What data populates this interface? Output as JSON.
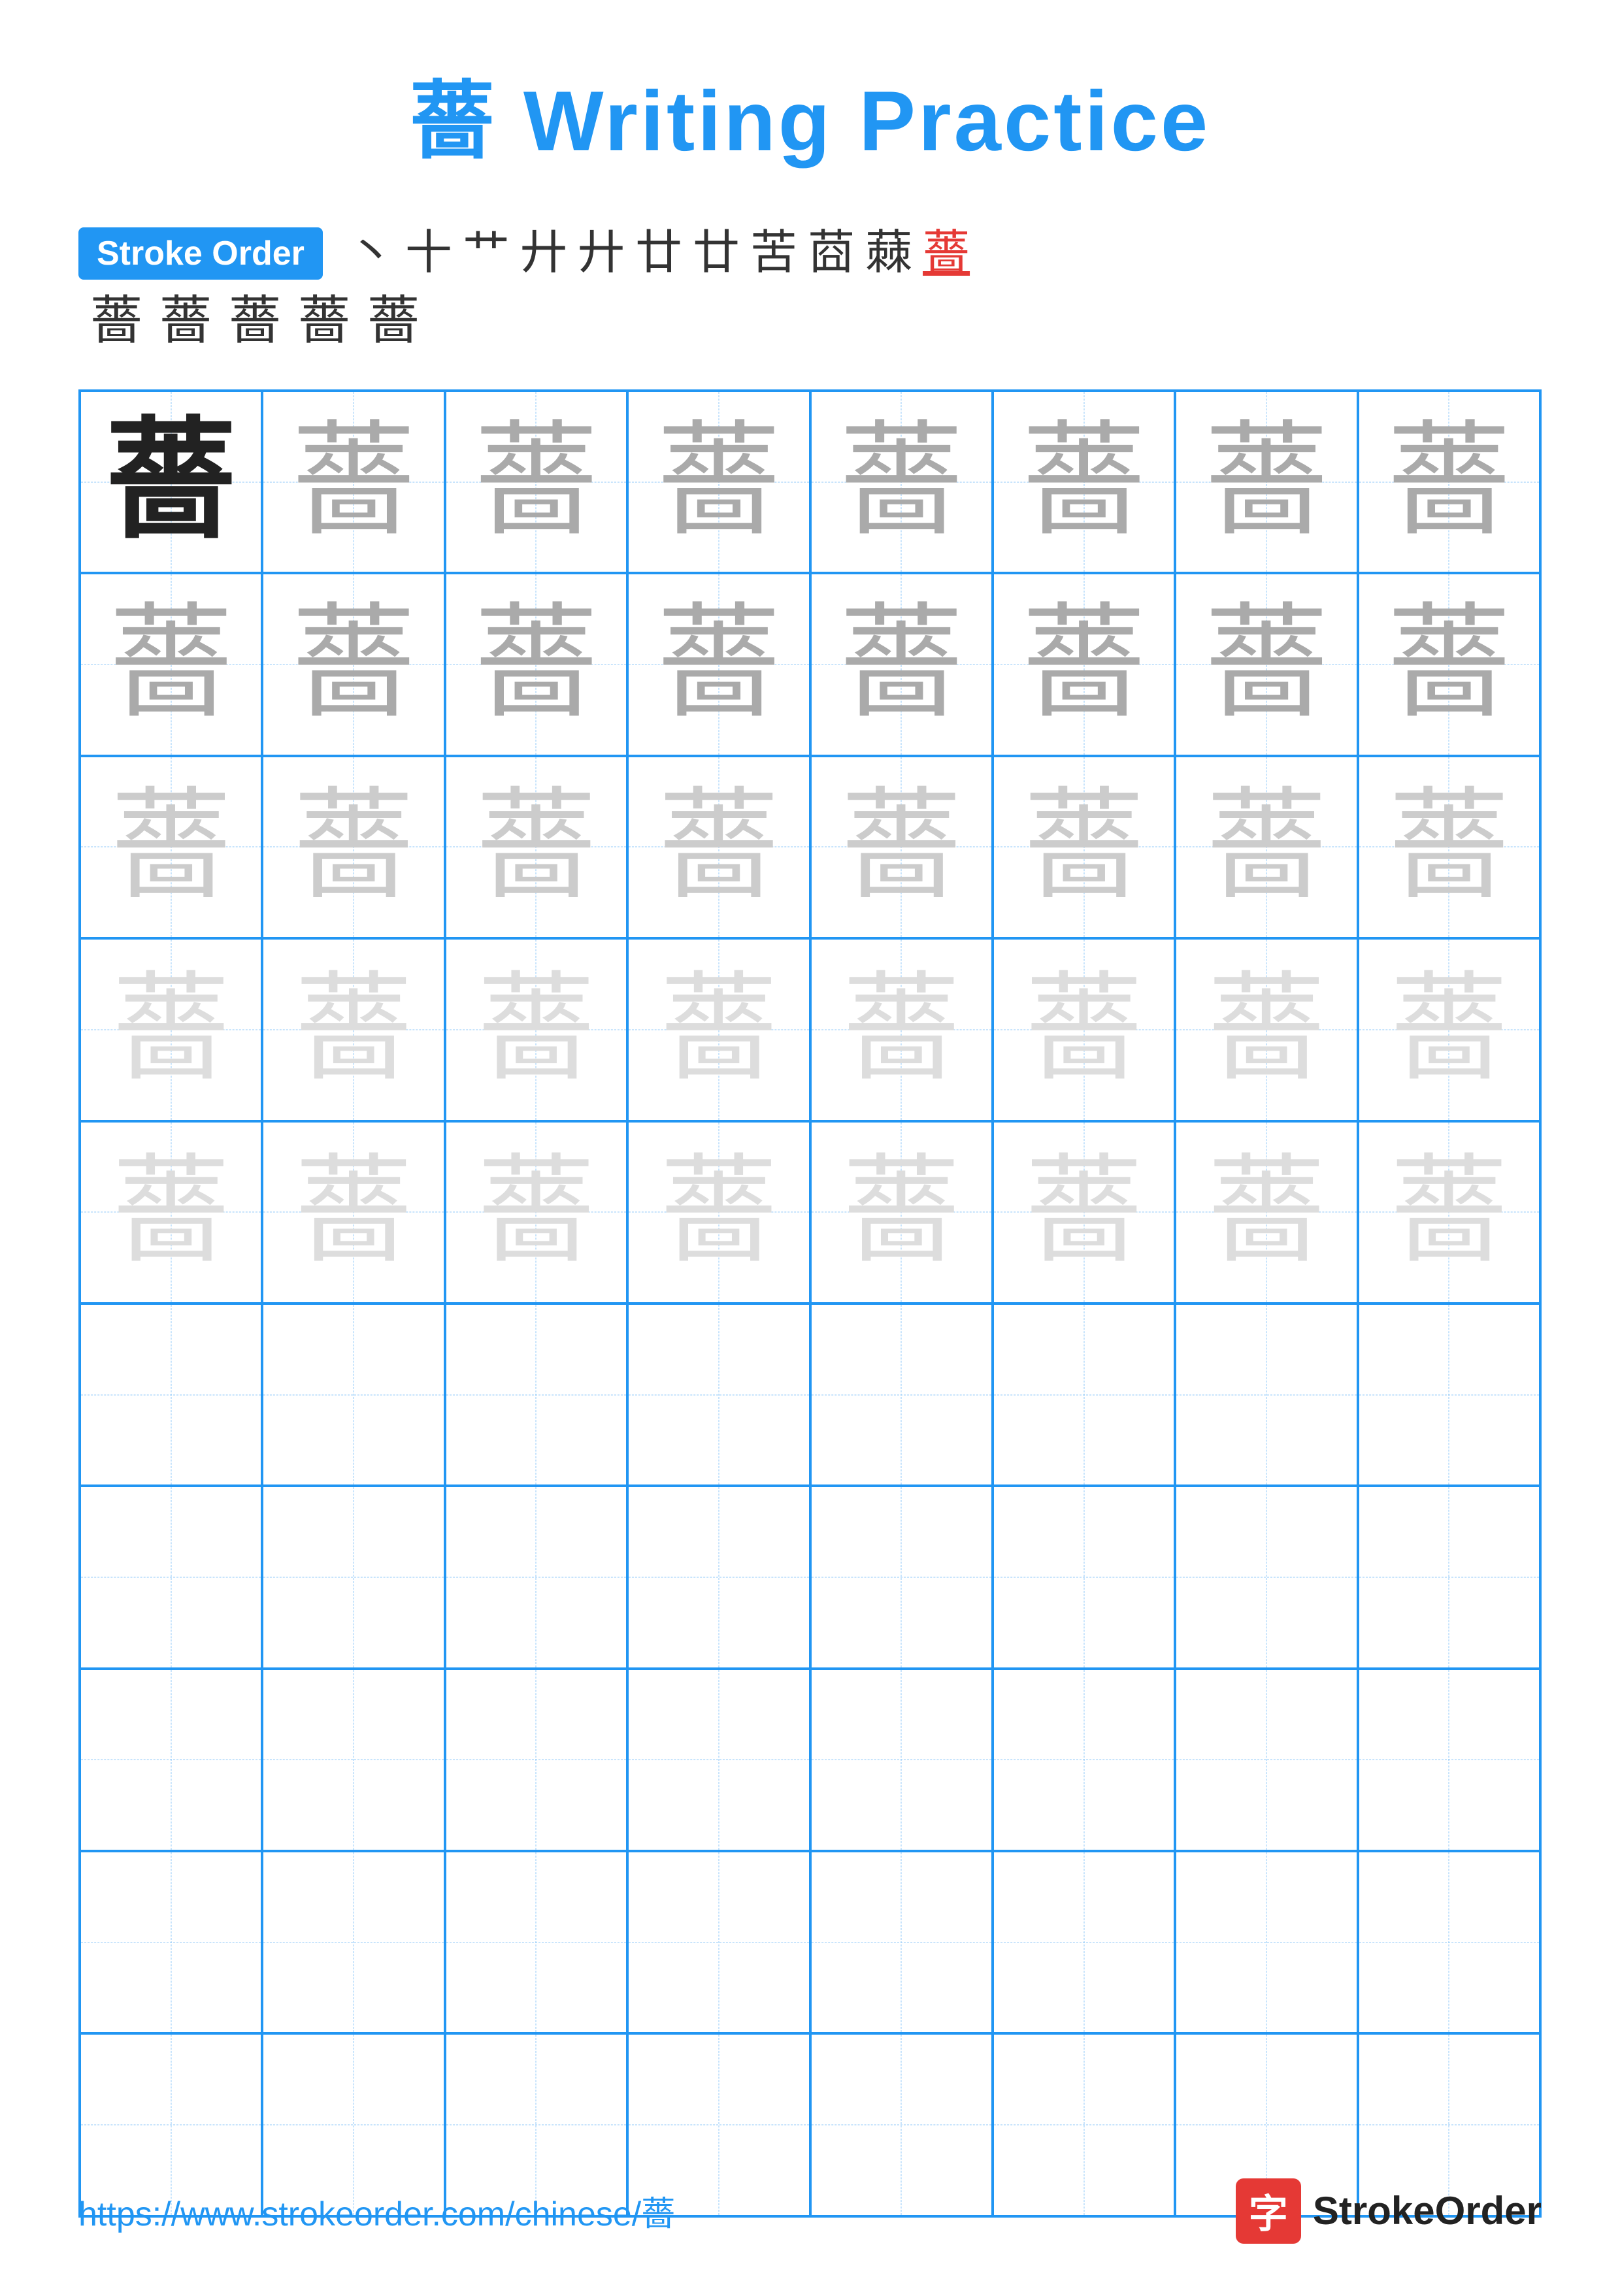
{
  "title": {
    "char": "薔",
    "text": " Writing Practice"
  },
  "stroke_order": {
    "badge_label": "Stroke Order",
    "row1_chars": [
      "丶",
      "十",
      "艹",
      "廾",
      "廾",
      "廿",
      "廿",
      "茣",
      "苳",
      "蕀",
      "薔"
    ],
    "row2_chars": [
      "薔",
      "薔",
      "薔",
      "薔",
      "薔"
    ]
  },
  "grid": {
    "rows": 10,
    "cols": 8,
    "char": "薔",
    "filled_rows": 5,
    "shades": [
      "dark",
      "medium",
      "light",
      "lighter",
      "lighter"
    ]
  },
  "footer": {
    "url": "https://www.strokeorder.com/chinese/薔",
    "brand_char": "字",
    "brand_name": "StrokeOrder"
  }
}
